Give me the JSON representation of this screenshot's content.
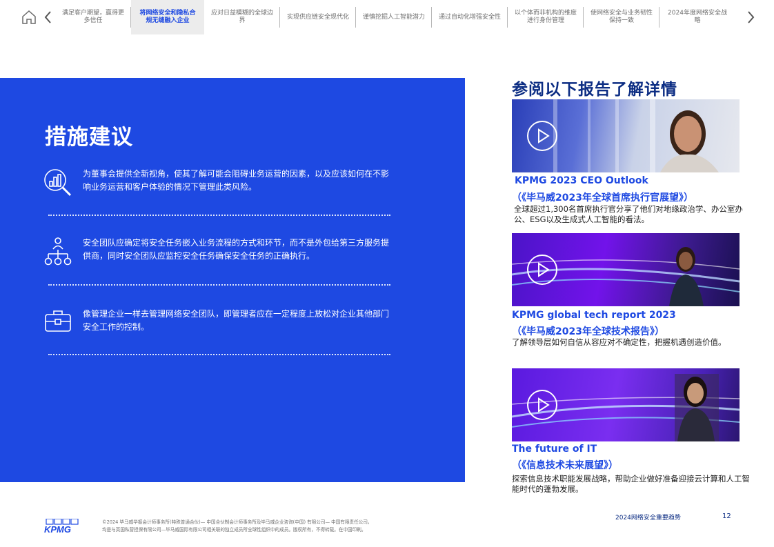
{
  "nav": {
    "tabs": [
      {
        "label": "满足客户期望，赢得更多信任",
        "active": false
      },
      {
        "label": "将网络安全和隐私合规无缝融入企业",
        "active": true
      },
      {
        "label": "应对日益模糊的全球边界",
        "active": false
      },
      {
        "label": "实现供应链安全现代化",
        "active": false
      },
      {
        "label": "谨慎挖掘人工智能潜力",
        "active": false
      },
      {
        "label": "通过自动化增强安全性",
        "active": false
      },
      {
        "label": "以个体而非机构的维度进行身份管理",
        "active": false
      },
      {
        "label": "使网络安全与业务韧性保持一致",
        "active": false
      },
      {
        "label": "2024年度网络安全战略",
        "active": false
      }
    ]
  },
  "panel": {
    "title": "措施建议",
    "recommendations": [
      {
        "icon": "analytics-magnifier-icon",
        "text": "为董事会提供全新视角，使其了解可能会阻碍业务运营的因素，以及应该如何在不影响业务运营和客户体验的情况下管理此类风险。"
      },
      {
        "icon": "org-chart-icon",
        "text": "安全团队应确定将安全任务嵌入业务流程的方式和环节，而不是外包给第三方服务提供商，同时安全团队应监控安全任务确保安全任务的正确执行。"
      },
      {
        "icon": "briefcase-icon",
        "text": "像管理企业一样去管理网络安全团队，即管理者应在一定程度上放松对企业其他部门安全工作的控制。"
      }
    ]
  },
  "side": {
    "heading": "参阅以下报告了解详情",
    "cards": [
      {
        "title": "KPMG 2023 CEO Outlook",
        "subtitle": "（《毕马威2023年全球首席执行官展望》）",
        "description": "全球超过1,300名首席执行官分享了他们对地缘政治学、办公室办公、ESG以及生成式人工智能的看法。"
      },
      {
        "title": "KPMG global tech report 2023",
        "subtitle": "（《毕马威2023年全球技术报告》）",
        "description": "了解领导层如何自信从容应对不确定性，把握机遇创造价值。"
      },
      {
        "title": "The future of IT",
        "subtitle": "（《信息技术未来展望》）",
        "description": "探索信息技术职能发展战略，帮助企业做好准备迎接云计算和人工智能时代的蓬勃发展。"
      }
    ]
  },
  "footer": {
    "logo_text": "KPMG",
    "copyright_line1": "©2024 毕马威华振会计师事务所(特殊普通合伙)— 中国合伙制会计师事务所及毕马威企业咨询(中国) 有限公司— 中国有限责任公司，",
    "copyright_line2": "均是与英国私营担保有限公司—毕马威国际有限公司相关联的独立成员所全球性组织中的成员。版权所有，不得转载。在中国印刷。",
    "report_title": "2024网络安全重要趋势",
    "page_number": "12"
  },
  "colors": {
    "brand_blue": "#1e49e2",
    "dark_blue": "#0c2d83",
    "purple": "#7213ea"
  }
}
